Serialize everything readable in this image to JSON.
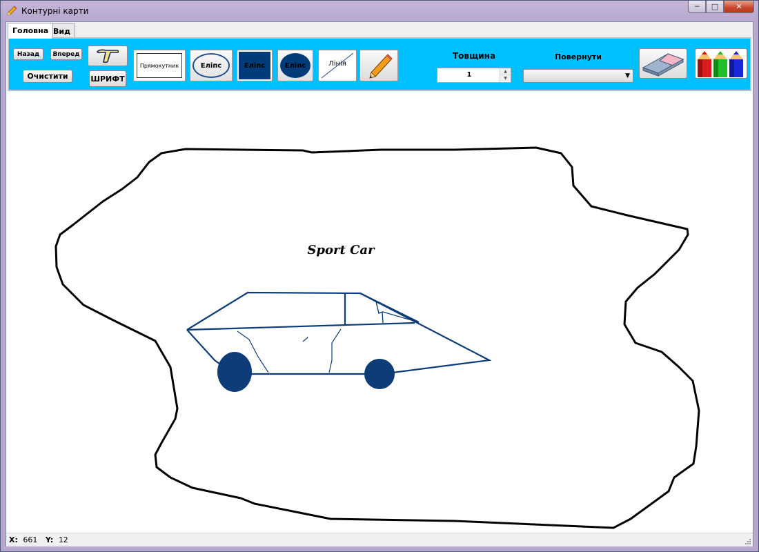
{
  "window": {
    "title": "Контурні карти",
    "min_icon": "minimize-icon",
    "max_icon": "maximize-icon",
    "close_icon": "close-icon"
  },
  "tabs": [
    {
      "label": "Головна",
      "active": true
    },
    {
      "label": "Вид",
      "active": false
    }
  ],
  "ribbon": {
    "back_label": "Назад",
    "forward_label": "Вперед",
    "clear_label": "Очистити",
    "text_tool_icon": "text-t-icon",
    "font_label": "ШРИФТ",
    "rect_label": "Прямокутник",
    "ellipse_outline_label": "Еліпс",
    "ellipse_square_label": "Еліпс",
    "ellipse_filled_label": "Еліпс",
    "line_label": "Лінія",
    "pencil_icon": "pencil-icon",
    "thickness_label": "Товщина",
    "thickness_value": "1",
    "rotate_label": "Повернути",
    "rotate_value": "",
    "eraser_icon": "eraser-icon",
    "colors_icon": "colored-pencils-icon",
    "accent_color": "#00bfff"
  },
  "canvas": {
    "drawing_text": "Sport Car",
    "stroke_color": "#0d3c78"
  },
  "status": {
    "x_label": "X:",
    "x_value": "661",
    "y_label": "Y:",
    "y_value": "12"
  }
}
